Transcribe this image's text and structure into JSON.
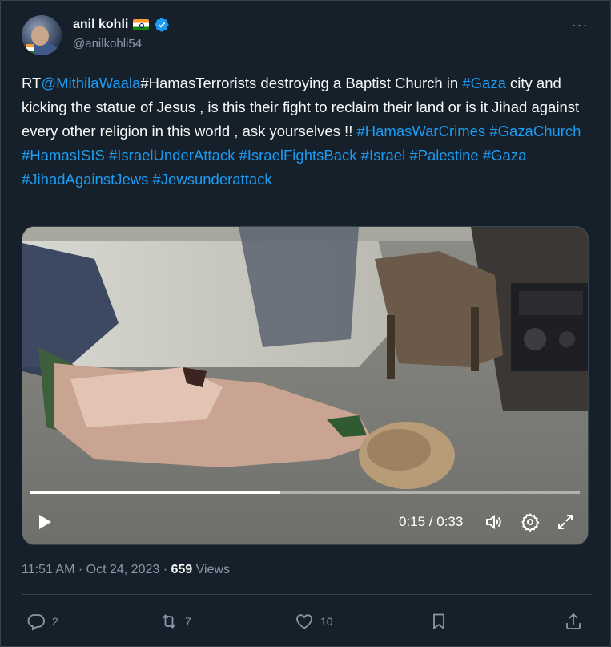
{
  "author": {
    "display_name": "anil kohli",
    "handle": "@anilkohli54",
    "flag_icon": "india-flag-icon",
    "verified_icon": "verified-badge-icon"
  },
  "tweet": {
    "segments": [
      {
        "text": "RT",
        "link": false
      },
      {
        "text": "@MithilaWaala",
        "link": true
      },
      {
        "text": "#HamasTerrorists destroying a Baptist Church in ",
        "link": false
      },
      {
        "text": "#Gaza",
        "link": true
      },
      {
        "text": " city and kicking the statue of Jesus , is this their fight to reclaim their land or is it Jihad against every other religion in this world , ask yourselves !!  ",
        "link": false
      },
      {
        "text": "#HamasWarCrimes",
        "link": true
      },
      {
        "text": " ",
        "link": false
      },
      {
        "text": "#GazaChurch",
        "link": true
      },
      {
        "text": " ",
        "link": false
      },
      {
        "text": "#HamasISIS",
        "link": true
      },
      {
        "text": " ",
        "link": false
      },
      {
        "text": "#IsraelUnderAttack",
        "link": true
      },
      {
        "text": " ",
        "link": false
      },
      {
        "text": "#IsraelFightsBack",
        "link": true
      },
      {
        "text": " ",
        "link": false
      },
      {
        "text": "#Israel",
        "link": true
      },
      {
        "text": " ",
        "link": false
      },
      {
        "text": "#Palestine",
        "link": true
      },
      {
        "text": " ",
        "link": false
      },
      {
        "text": "#Gaza",
        "link": true
      },
      {
        "text": " ",
        "link": false
      },
      {
        "text": "#JihadAgainstJews",
        "link": true
      },
      {
        "text": " ",
        "link": false
      },
      {
        "text": "#Jewsunderattack",
        "link": true
      }
    ]
  },
  "video": {
    "time_display": "0:15 / 0:33",
    "progress": 0.4545,
    "controls": [
      "play-icon",
      "volume-icon",
      "settings-gear-icon",
      "fullscreen-icon"
    ]
  },
  "meta": {
    "time": "11:51 AM",
    "separator": " · ",
    "date": "Oct 24, 2023",
    "views_count": "659",
    "views_label": " Views"
  },
  "actions": {
    "replies": "2",
    "retweets": "7",
    "likes": "10"
  },
  "colors": {
    "background": "#15202b",
    "text": "#f7f9f9",
    "secondary": "#8b98a5",
    "link": "#1d9bf0",
    "border": "#38444d"
  }
}
